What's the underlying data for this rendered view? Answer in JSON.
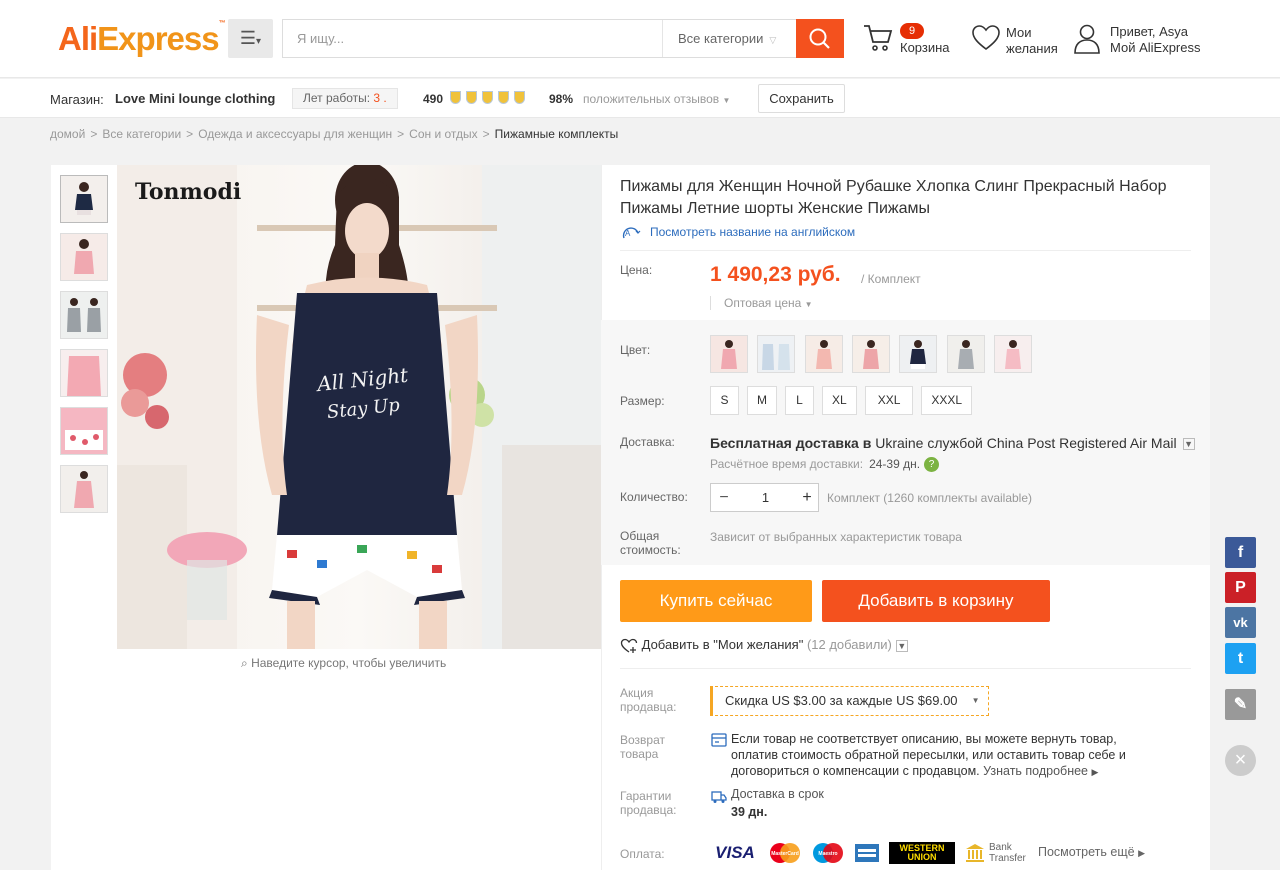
{
  "header": {
    "logo_part1": "Ali",
    "logo_part2": "Express",
    "search_placeholder": "Я ищу...",
    "category_select": "Все категории",
    "cart_count": "9",
    "cart_label": "Корзина",
    "wishlist_label_1": "Мои",
    "wishlist_label_2": "желания",
    "greeting": "Привет, Asya",
    "account_label": "Мой AliExpress"
  },
  "store": {
    "label": "Магазин:",
    "name": "Love Mini lounge clothing",
    "years_label": "Лет работы:",
    "years_value": "3 .",
    "rating": "490",
    "positive_pct": "98%",
    "positive_label": "положительных отзывов",
    "save_label": "Сохранить"
  },
  "breadcrumb": [
    "домой",
    "Все категории",
    "Одежда и аксессуары для женщин",
    "Сон и отдых",
    "Пижамные комплекты"
  ],
  "product": {
    "brand": "Tonmodi",
    "shirt_text_1": "All Night",
    "shirt_text_2": "Stay Up",
    "zoom_hint": "Наведите курсор, чтобы увеличить",
    "title": "Пижамы для Женщин Ночной Рубашке Хлопка Слинг Прекрасный Набор Пижамы Летние шорты Женские Пижамы",
    "english_link": "Посмотреть название на английском",
    "price_label": "Цена:",
    "price": "1 490,23 руб.",
    "price_unit": "/ Комплект",
    "wholesale": "Оптовая цена",
    "color_label": "Цвет:",
    "size_label": "Размер:",
    "sizes": [
      "S",
      "M",
      "L",
      "XL",
      "XXL",
      "XXXL"
    ],
    "shipping_label": "Доставка:",
    "shipping_free": "Бесплатная доставка в",
    "shipping_country": "Ukraine",
    "shipping_by": "службой",
    "shipping_carrier": "China Post Registered Air Mail",
    "delivery_time_label": "Расчётное время доставки:",
    "delivery_time": "24-39 дн.",
    "quantity_label": "Количество:",
    "quantity": "1",
    "quantity_avail": "Комплект (1260 комплекты available)",
    "total_label_1": "Общая",
    "total_label_2": "стоимость:",
    "total_text": "Зависит от выбранных характеристик товара",
    "buy_now": "Купить сейчас",
    "add_to_cart": "Добавить в корзину",
    "add_wish": "Добавить в \"Мои желания\"",
    "wish_count": "(12 добавили)",
    "promo_label_1": "Акция",
    "promo_label_2": "продавца:",
    "promo_text_1": "Скидка",
    "promo_amount": "US $3.00",
    "promo_text_2": "за каждые",
    "promo_threshold": "US $69.00",
    "return_label_1": "Возврат",
    "return_label_2": "товара",
    "return_text": "Если товар не соответствует описанию, вы можете вернуть товар, оплатив стоимость обратной пересылки, или оставить товар себе и договориться о компенсации с продавцом.",
    "return_more": "Узнать подробнее",
    "guarantee_label_1": "Гарантии",
    "guarantee_label_2": "продавца:",
    "guarantee_title": "Доставка в срок",
    "guarantee_days": "39 дн.",
    "payment_label": "Оплата:",
    "payment_visa": "VISA",
    "payment_mastercard": "MasterCard",
    "payment_maestro": "Maestro",
    "payment_wu_1": "WESTERN",
    "payment_wu_2": "UNION",
    "payment_bank_1": "Bank",
    "payment_bank_2": "Transfer",
    "payment_more": "Посмотреть ещё"
  },
  "colors": {
    "accent": "#f4511e",
    "buy": "#ff9a18",
    "link": "#2c6cbd",
    "facebook": "#3b5998",
    "pinterest": "#cb2027",
    "vk": "#4c75a3",
    "twitter": "#1da1f2"
  },
  "share": {
    "facebook_icon": "f",
    "pinterest_icon": "P",
    "vk_icon": "vk",
    "twitter_icon": "t",
    "edit_icon": "✎",
    "close_icon": "×"
  }
}
